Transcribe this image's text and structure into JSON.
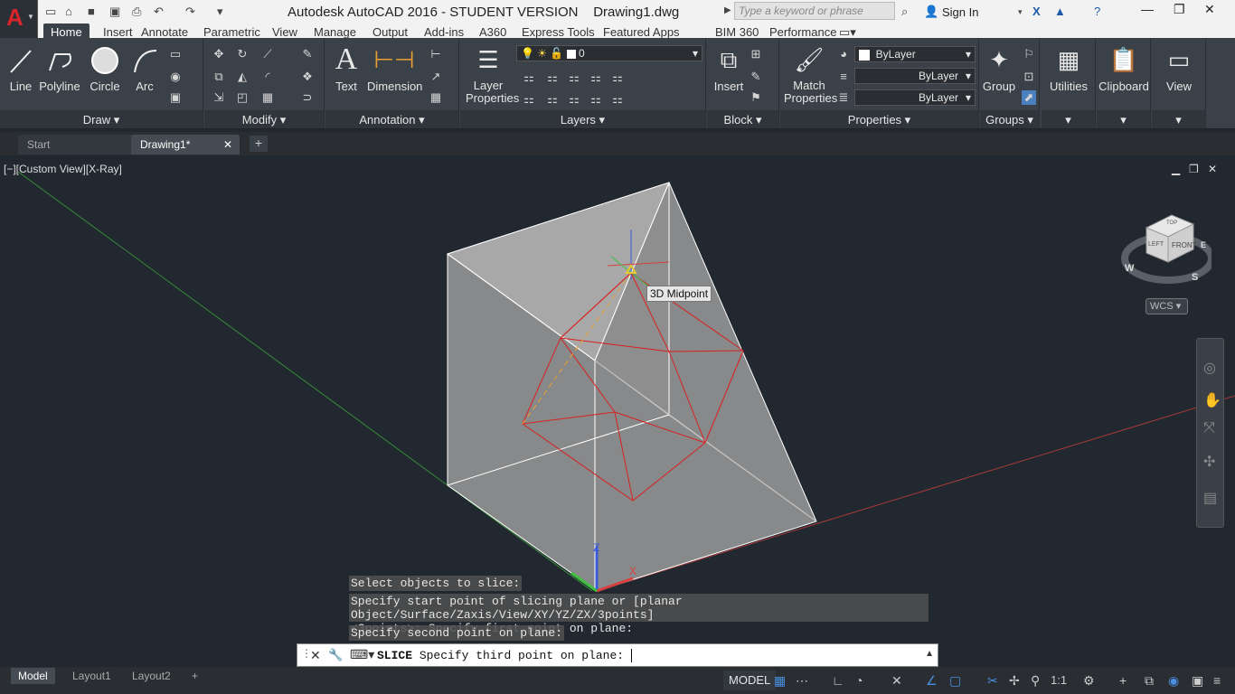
{
  "titlebar": {
    "app_title": "Autodesk AutoCAD 2016 - STUDENT VERSION",
    "file_name": "Drawing1.dwg",
    "search_placeholder": "Type a keyword or phrase",
    "sign_in": "Sign In"
  },
  "ribbon_tabs": [
    "Home",
    "Insert",
    "Annotate",
    "Parametric",
    "View",
    "Manage",
    "Output",
    "Add-ins",
    "A360",
    "Express Tools",
    "Featured Apps",
    "BIM 360",
    "Performance"
  ],
  "draw_panel": {
    "title": "Draw",
    "line": "Line",
    "polyline": "Polyline",
    "circle": "Circle",
    "arc": "Arc"
  },
  "modify_panel": {
    "title": "Modify"
  },
  "annotation_panel": {
    "title": "Annotation",
    "text": "Text",
    "dimension": "Dimension"
  },
  "layers_panel": {
    "title": "Layers",
    "layer_properties": "Layer Properties",
    "current_layer": "0"
  },
  "block_panel": {
    "title": "Block",
    "insert": "Insert"
  },
  "properties_panel": {
    "title": "Properties",
    "match": "Match Properties",
    "color": "ByLayer",
    "linetype": "ByLayer",
    "lineweight": "ByLayer"
  },
  "groups_panel": {
    "title": "Groups",
    "group": "Group"
  },
  "utilities": "Utilities",
  "clipboard": "Clipboard",
  "view": "View",
  "file_tabs": {
    "start": "Start",
    "drawing": "Drawing1*"
  },
  "viewport": {
    "label": "[−][Custom View][X-Ray]",
    "tooltip": "3D Midpoint",
    "wcs": "WCS",
    "cube_top": "TOP",
    "cube_left": "LEFT",
    "cube_front": "FRONT",
    "compass_w": "W",
    "compass_s": "S",
    "compass_e": "E"
  },
  "command_history": [
    "Select objects to slice:",
    "Specify start point of slicing plane or [planar Object/Surface/Zaxis/View/XY/YZ/ZX/3points]",
    "<3points>:  Specify first point on plane:",
    "Specify second point on plane:"
  ],
  "command_line": {
    "cmd": "SLICE",
    "prompt": "Specify third point on plane: "
  },
  "layout_tabs": [
    "Model",
    "Layout1",
    "Layout2"
  ],
  "status": {
    "model": "MODEL",
    "scale": "1:1"
  }
}
